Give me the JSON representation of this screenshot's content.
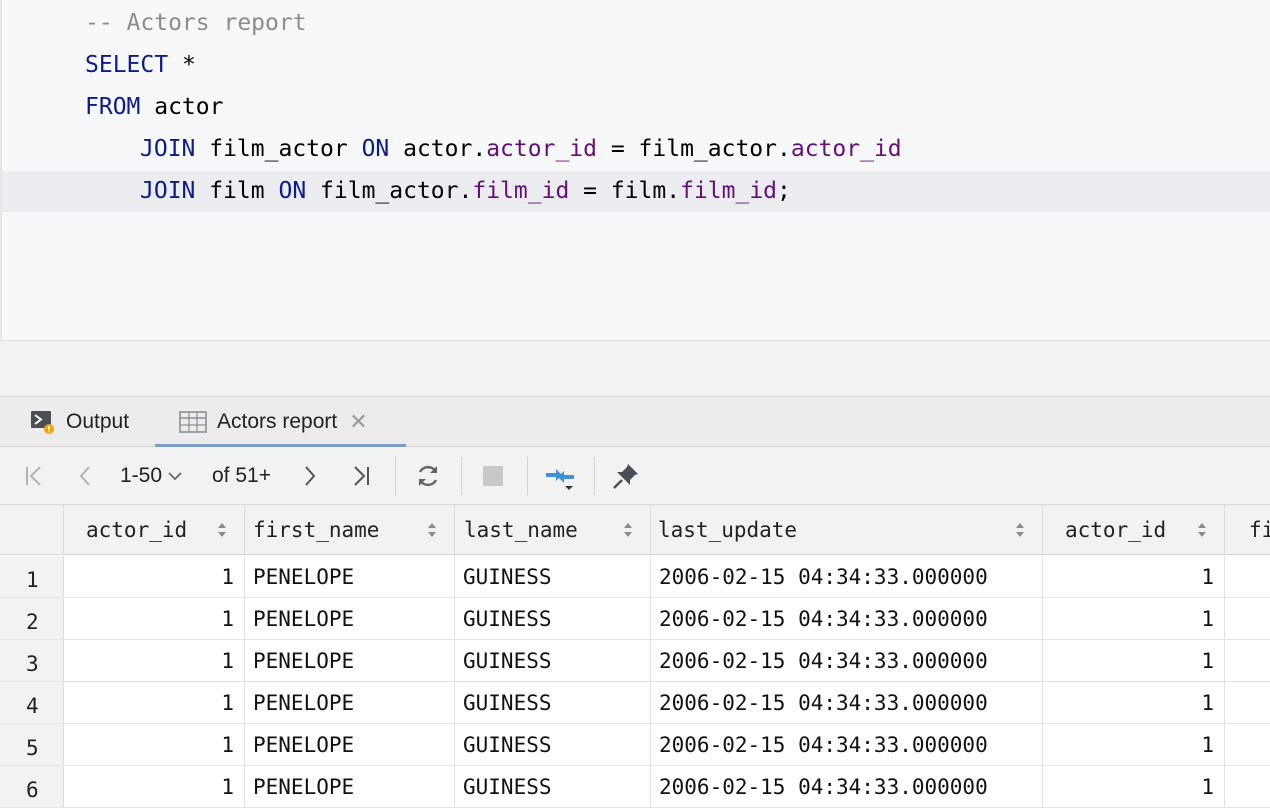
{
  "editor": {
    "comment": "-- Actors report",
    "kw_select": "SELECT",
    "select_rest": " *",
    "kw_from": "FROM",
    "from_rest": " actor",
    "line4": {
      "kw_join": "JOIN",
      "t1": " film_actor ",
      "kw_on": "ON",
      "t2": " actor.",
      "f1": "actor_id",
      "t3": " = film_actor.",
      "f2": "actor_id"
    },
    "line5": {
      "kw_join": "JOIN",
      "t1": " film ",
      "kw_on": "ON",
      "t2": " film_actor.",
      "f1": "film_id",
      "t3": " = film.",
      "f2": "film_id",
      "t4": ";"
    }
  },
  "tabs": [
    {
      "label": "Output",
      "icon": "console-output-icon"
    },
    {
      "label": "Actors report",
      "icon": "table-icon"
    }
  ],
  "toolbar": {
    "page_range": "1-50",
    "page_total": "of 51+"
  },
  "grid": {
    "columns": [
      "actor_id",
      "first_name",
      "last_name",
      "last_update",
      "actor_id",
      "fi"
    ],
    "rows": [
      {
        "n": "1",
        "actor_id": "1",
        "first_name": "PENELOPE",
        "last_name": "GUINESS",
        "last_update": "2006-02-15 04:34:33.000000",
        "actor_id2": "1"
      },
      {
        "n": "2",
        "actor_id": "1",
        "first_name": "PENELOPE",
        "last_name": "GUINESS",
        "last_update": "2006-02-15 04:34:33.000000",
        "actor_id2": "1"
      },
      {
        "n": "3",
        "actor_id": "1",
        "first_name": "PENELOPE",
        "last_name": "GUINESS",
        "last_update": "2006-02-15 04:34:33.000000",
        "actor_id2": "1"
      },
      {
        "n": "4",
        "actor_id": "1",
        "first_name": "PENELOPE",
        "last_name": "GUINESS",
        "last_update": "2006-02-15 04:34:33.000000",
        "actor_id2": "1"
      },
      {
        "n": "5",
        "actor_id": "1",
        "first_name": "PENELOPE",
        "last_name": "GUINESS",
        "last_update": "2006-02-15 04:34:33.000000",
        "actor_id2": "1"
      },
      {
        "n": "6",
        "actor_id": "1",
        "first_name": "PENELOPE",
        "last_name": "GUINESS",
        "last_update": "2006-02-15 04:34:33.000000",
        "actor_id2": "1"
      }
    ]
  }
}
